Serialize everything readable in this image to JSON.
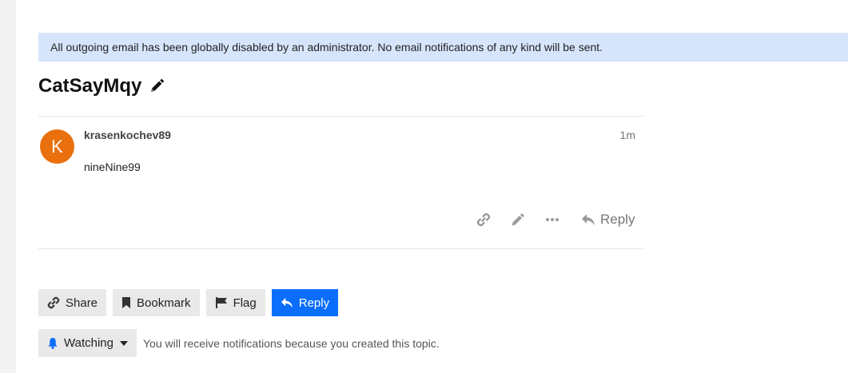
{
  "banner": {
    "text": "All outgoing email has been globally disabled by an administrator. No email notifications of any kind will be sent."
  },
  "topic": {
    "title": "CatSayMqy"
  },
  "post": {
    "avatar_letter": "K",
    "avatar_color": "#e9700d",
    "username": "krasenkochev89",
    "age": "1m",
    "body": "nineNine99",
    "actions": {
      "reply_label": "Reply",
      "icons": [
        "link-icon",
        "pencil-icon",
        "ellipsis-icon",
        "reply-icon"
      ]
    }
  },
  "footer": {
    "share_label": "Share",
    "bookmark_label": "Bookmark",
    "flag_label": "Flag",
    "reply_label": "Reply"
  },
  "notifications": {
    "level_label": "Watching",
    "reason": "You will receive notifications because you created this topic."
  },
  "colors": {
    "banner_bg": "#d6e5fb",
    "primary": "#0a6efb",
    "avatar": "#e9700d",
    "bell": "#0a6efb"
  }
}
